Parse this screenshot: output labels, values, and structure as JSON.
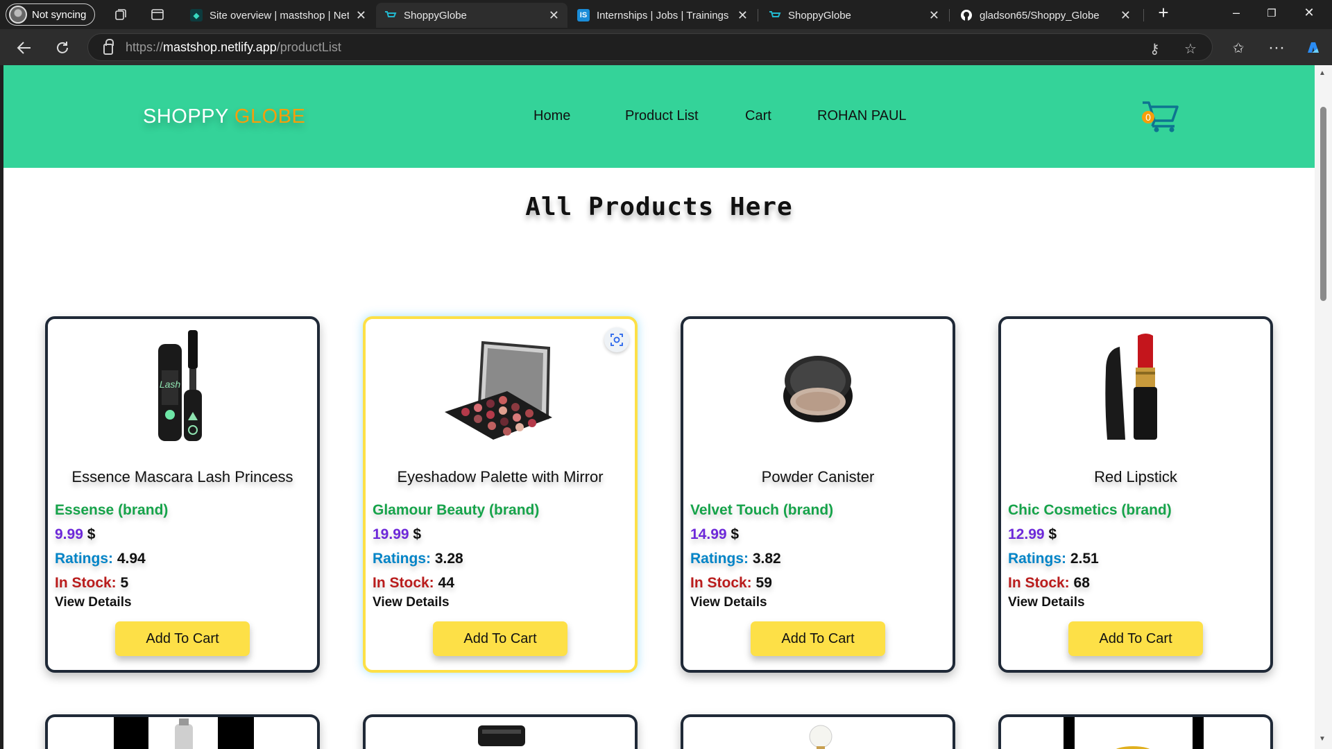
{
  "browser": {
    "profile_label": "Not syncing",
    "tabs": [
      {
        "title": "Site overview | mastshop | Net",
        "favicon": "netlify-icon"
      },
      {
        "title": "ShoppyGlobe",
        "favicon": "shoppyglobe-icon"
      },
      {
        "title": "Internships | Jobs | Trainings &",
        "favicon": "internshala-icon"
      },
      {
        "title": "ShoppyGlobe",
        "favicon": "shoppyglobe-icon"
      },
      {
        "title": "gladson65/Shoppy_Globe",
        "favicon": "github-icon"
      }
    ],
    "active_tab": 1,
    "url_scheme": "https://",
    "url_host": "mastshop.netlify.app",
    "url_path": "/productList"
  },
  "site": {
    "logo_main": "SHOPPY ",
    "logo_accent": "GLOBE",
    "nav": [
      "Home",
      "Product List",
      "Cart",
      "ROHAN PAUL"
    ],
    "cart_count": "0",
    "heading": "All Products Here",
    "colors": {
      "header_bg": "#34d399",
      "accent": "#f59e0b",
      "button": "#fde047"
    }
  },
  "labels": {
    "ratings": "Ratings:",
    "stock": "In Stock:",
    "brand_suffix": " (brand)",
    "currency": " $",
    "view_details": "View Details",
    "add_to_cart": "Add To Cart"
  },
  "products": [
    {
      "name": "Essence Mascara Lash Princess",
      "brand": "Essense",
      "price": "9.99",
      "rating": "4.94",
      "stock": "5"
    },
    {
      "name": "Eyeshadow Palette with Mirror",
      "brand": "Glamour Beauty",
      "price": "19.99",
      "rating": "3.28",
      "stock": "44"
    },
    {
      "name": "Powder Canister",
      "brand": "Velvet Touch",
      "price": "14.99",
      "rating": "3.82",
      "stock": "59"
    },
    {
      "name": "Red Lipstick",
      "brand": "Chic Cosmetics",
      "price": "12.99",
      "rating": "2.51",
      "stock": "68"
    }
  ]
}
